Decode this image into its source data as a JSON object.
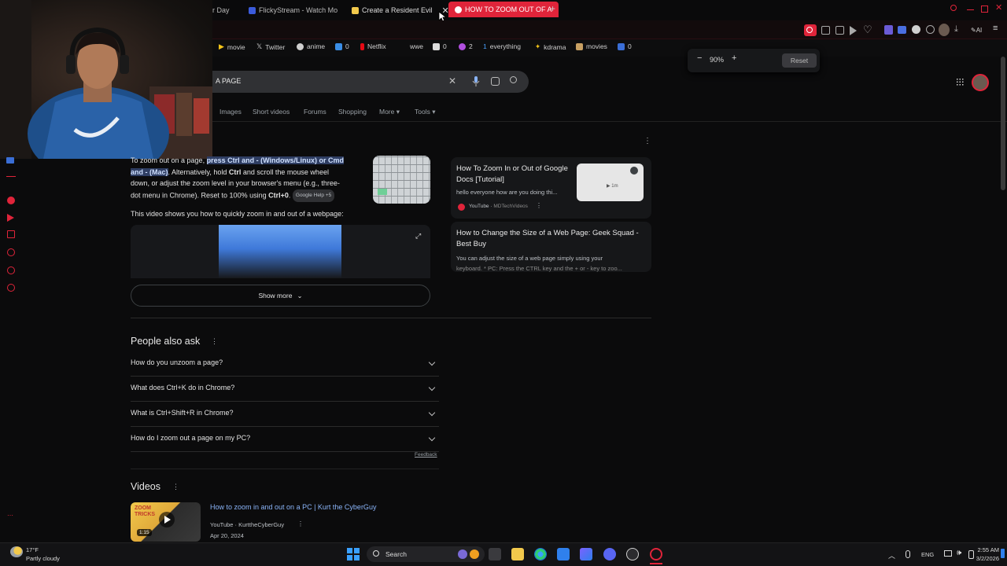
{
  "tabs": [
    {
      "label": "r Day"
    },
    {
      "label": "FlickyStream - Watch Mo"
    },
    {
      "label": "Create a Resident Evil"
    },
    {
      "label": "HOW TO ZOOM OUT OF A"
    }
  ],
  "bookmarks": [
    "movie",
    "Twitter",
    "anime",
    "0",
    "Netflix",
    "wwe",
    "0",
    "2",
    "everything",
    "kdrama",
    "movies",
    "0"
  ],
  "toolbar": {
    "ai_label": "AI"
  },
  "zoom": {
    "minus": "−",
    "level": "90%",
    "plus": "+",
    "reset": "Reset"
  },
  "search": {
    "query": "A PAGE"
  },
  "nav_tabs": [
    "Images",
    "Short videos",
    "Forums",
    "Shopping",
    "More",
    "Tools"
  ],
  "overview": {
    "intro": "To zoom out on a page, ",
    "highlight_1": "press Ctrl and - (Windows/Linux) or Cmd",
    "highlight_2": "and - (Mac)",
    "rest_1": ". Alternatively, hold ",
    "ctrl": "Ctrl",
    "rest_2": " and scroll the mouse wheel",
    "line3": "down, or adjust the zoom level in your browser's menu (e.g., three-",
    "line4a": "dot menu in Chrome). Reset to 100% using ",
    "ctrl0": "Ctrl+0",
    "line4b": ".",
    "source": "Google Help +5",
    "video_caption": "This video shows you how to quickly zoom in and out of a webpage:",
    "show_more": "Show more"
  },
  "right_results": [
    {
      "title_1": "How To Zoom In or Out of Google",
      "title_2": "Docs [Tutorial]",
      "snippet": "hello everyone how are you doing thi...",
      "source": "YouTube",
      "channel": "MDTechVideos",
      "thumb_time": "1m"
    },
    {
      "title_1": "How to Change the Size of a Web Page: Geek Squad -",
      "title_2": "Best Buy",
      "snippet_1": "You can adjust the size of a web page simply using your",
      "snippet_2": "keyboard. * PC: Press the CTRL key and the + or - key to zoo..."
    }
  ],
  "paa": {
    "heading": "People also ask",
    "questions": [
      "How do you unzoom a page?",
      "What does Ctrl+K do in Chrome?",
      "What is Ctrl+Shift+R in Chrome?",
      "How do I zoom out a page on my PC?"
    ],
    "feedback": "Feedback"
  },
  "videos": {
    "heading": "Videos",
    "item_title": "How to zoom in and out on a PC | Kurt the CyberGuy",
    "item_source": "YouTube · KurttheCyberGuy",
    "item_date": "Apr 20, 2024",
    "thumb_text": "ZOOM TRICKS",
    "duration": "1:15"
  },
  "taskbar": {
    "weather_temp": "17°F",
    "weather_desc": "Partly cloudy",
    "search_label": "Search",
    "lang": "ENG",
    "time": "2:55 AM",
    "date": "3/2/2026"
  },
  "colors": {
    "accent": "#e0243a",
    "highlight": "#2f3e63",
    "link": "#8ab4f8"
  }
}
